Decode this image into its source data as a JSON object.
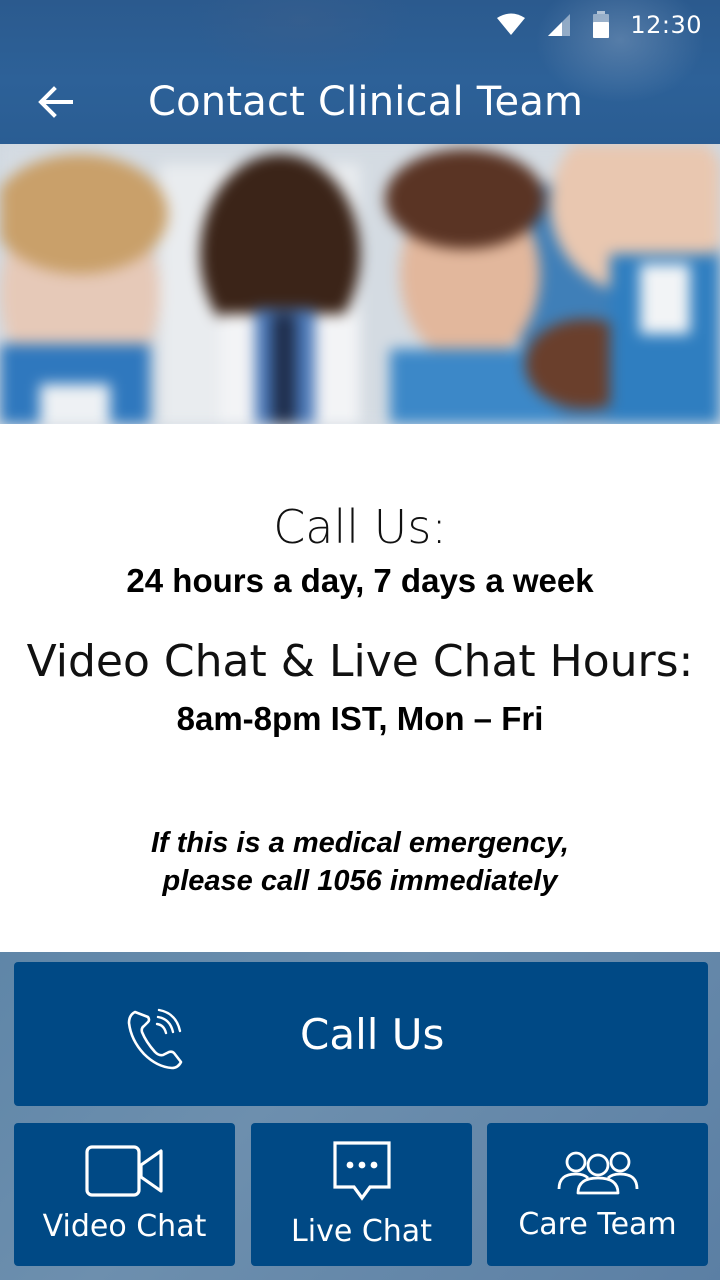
{
  "status_bar": {
    "time": "12:30",
    "icons": [
      "wifi-icon",
      "signal-icon",
      "battery-icon"
    ]
  },
  "app_bar": {
    "title": "Contact Clinical Team",
    "back_icon": "arrow-back-icon"
  },
  "hero": {
    "description": "blurred photo of smiling clinical staff"
  },
  "info": {
    "call_heading": "Call Us:",
    "call_hours": "24 hours a day, 7 days a week",
    "chat_heading": "Video Chat & Live Chat Hours:",
    "chat_hours": "8am-8pm IST, Mon – Fri",
    "emergency_line1": "If this is a medical emergency,",
    "emergency_line2": "please call 1056 immediately"
  },
  "actions": {
    "call": {
      "label": "Call Us",
      "icon": "phone-icon"
    },
    "video": {
      "label": "Video Chat",
      "icon": "video-camera-icon"
    },
    "live": {
      "label": "Live Chat",
      "icon": "chat-bubble-icon"
    },
    "care": {
      "label": "Care Team",
      "icon": "group-icon"
    }
  },
  "colors": {
    "app_bar": "#2d6198",
    "button": "#004985",
    "actions_bg": "#6d8fae",
    "text": "#000000"
  }
}
